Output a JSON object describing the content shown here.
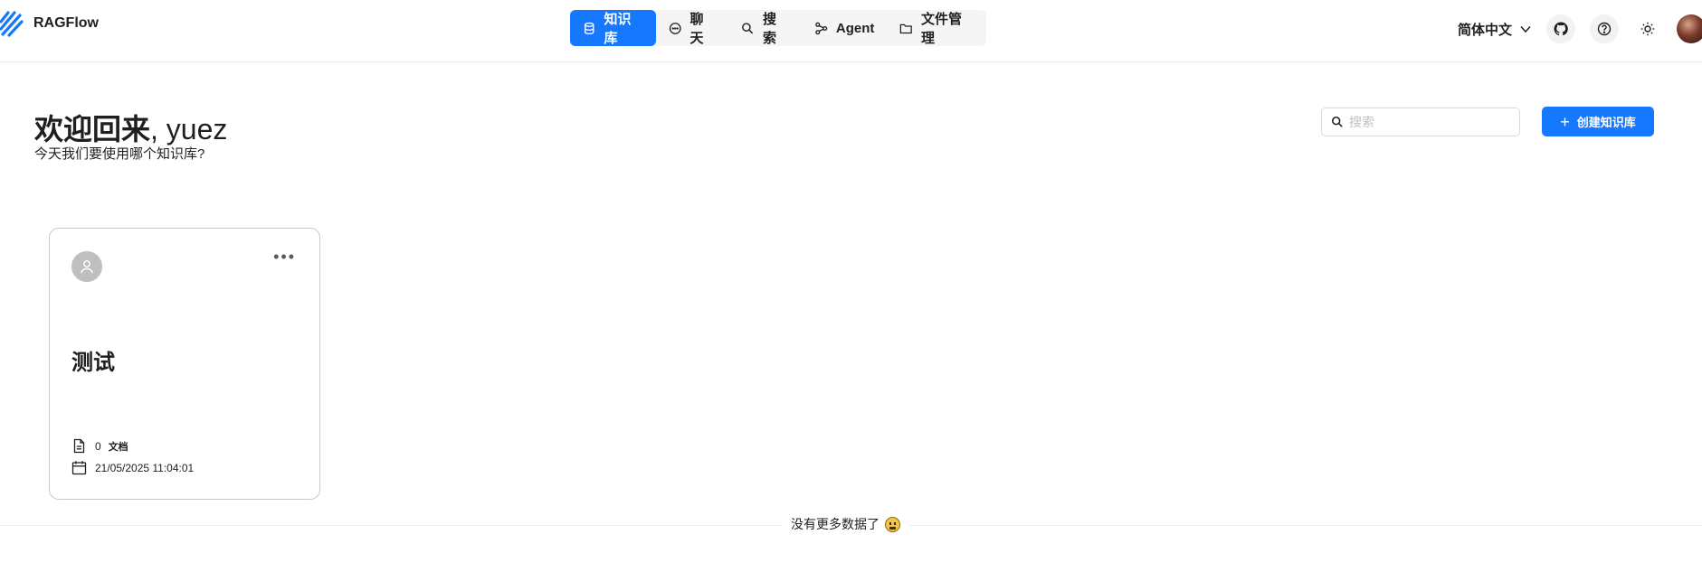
{
  "app": {
    "name": "RAGFlow"
  },
  "nav": {
    "items": [
      {
        "label": "知识库",
        "icon": "database-icon",
        "active": true
      },
      {
        "label": "聊天",
        "icon": "chat-icon",
        "active": false
      },
      {
        "label": "搜索",
        "icon": "search-icon",
        "active": false
      },
      {
        "label": "Agent",
        "icon": "agent-icon",
        "active": false
      },
      {
        "label": "文件管理",
        "icon": "folder-icon",
        "active": false
      }
    ]
  },
  "header_right": {
    "language": "简体中文",
    "icons": [
      "github-icon",
      "help-icon",
      "theme-sun-icon"
    ]
  },
  "welcome": {
    "prefix": "欢迎回来",
    "name": ", yuez",
    "subtitle": "今天我们要使用哪个知识库?"
  },
  "search": {
    "placeholder": "搜索",
    "value": ""
  },
  "create_button": {
    "label": "创建知识库"
  },
  "knowledge_bases": [
    {
      "title": "测试",
      "doc_count": "0",
      "doc_label": "文档",
      "updated_at": "21/05/2025 11:04:01"
    }
  ],
  "footer": {
    "no_more": "没有更多数据了"
  },
  "colors": {
    "primary": "#1677ff",
    "nav_bg": "#f5f5f5",
    "border": "#c8c8c8"
  }
}
